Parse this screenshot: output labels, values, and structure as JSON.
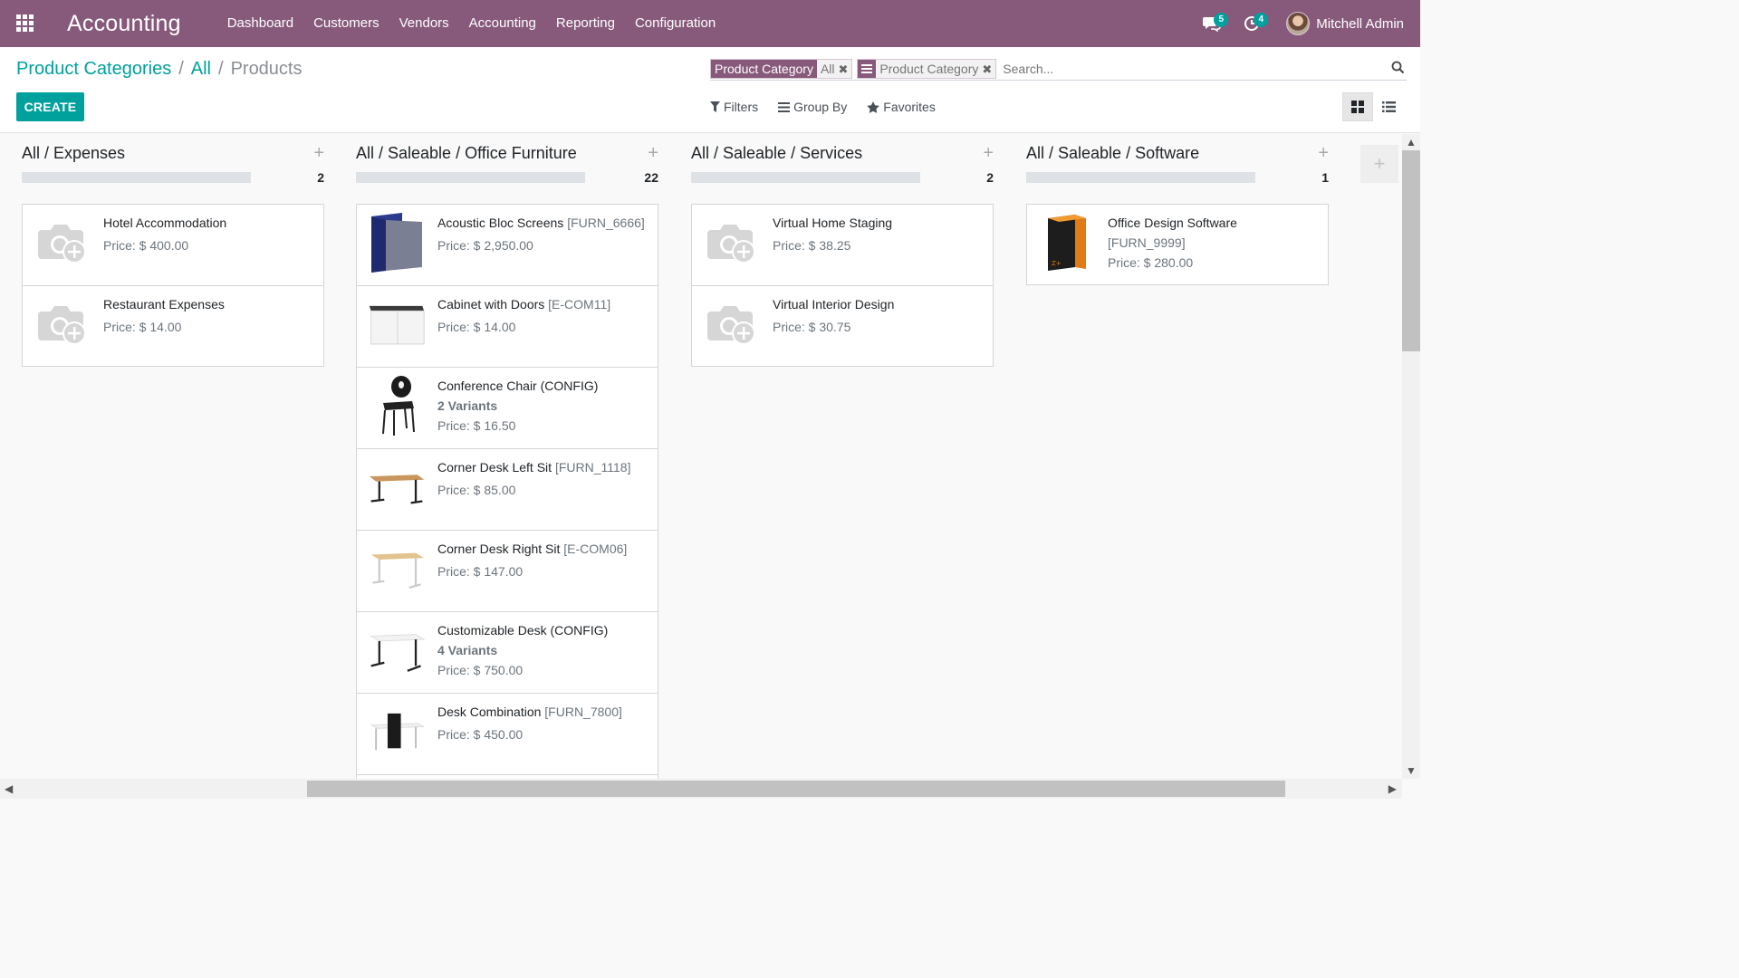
{
  "colors": {
    "brand": "#875a7b",
    "accent": "#00a09d"
  },
  "navbar": {
    "app_name": "Accounting",
    "menu": [
      "Dashboard",
      "Customers",
      "Vendors",
      "Accounting",
      "Reporting",
      "Configuration"
    ],
    "messages_count": "5",
    "activities_count": "4",
    "user_name": "Mitchell Admin"
  },
  "breadcrumb": {
    "level1": "Product Categories",
    "level2": "All",
    "current": "Products",
    "sep": "/"
  },
  "toolbar": {
    "create_label": "CREATE"
  },
  "search": {
    "facet1_label": "Product Category",
    "facet1_value": "All",
    "facet2_value": "Product Category",
    "placeholder": "Search...",
    "filters_label": "Filters",
    "groupby_label": "Group By",
    "favorites_label": "Favorites"
  },
  "columns": [
    {
      "title": "All / Expenses",
      "count": "2",
      "cards": [
        {
          "name": "Hotel Accommodation",
          "ref": "",
          "variants": "",
          "price": "Price: $ 400.00",
          "image": "placeholder"
        },
        {
          "name": "Restaurant Expenses",
          "ref": "",
          "variants": "",
          "price": "Price: $ 14.00",
          "image": "placeholder"
        }
      ]
    },
    {
      "title": "All / Saleable / Office Furniture",
      "count": "22",
      "cards": [
        {
          "name": "Acoustic Bloc Screens",
          "ref": "[FURN_6666]",
          "variants": "",
          "price": "Price: $ 2,950.00",
          "image": "screens"
        },
        {
          "name": "Cabinet with Doors",
          "ref": "[E-COM11]",
          "variants": "",
          "price": "Price: $ 14.00",
          "image": "cabinet"
        },
        {
          "name": "Conference Chair (CONFIG)",
          "ref": "",
          "variants": "2 Variants",
          "price": "Price: $ 16.50",
          "image": "chair"
        },
        {
          "name": "Corner Desk Left Sit",
          "ref": "[FURN_1118]",
          "variants": "",
          "price": "Price: $ 85.00",
          "image": "desk-left"
        },
        {
          "name": "Corner Desk Right Sit",
          "ref": "[E-COM06]",
          "variants": "",
          "price": "Price: $ 147.00",
          "image": "desk-right"
        },
        {
          "name": "Customizable Desk (CONFIG)",
          "ref": "",
          "variants": "4 Variants",
          "price": "Price: $ 750.00",
          "image": "desk-custom"
        },
        {
          "name": "Desk Combination",
          "ref": "[FURN_7800]",
          "variants": "",
          "price": "Price: $ 450.00",
          "image": "desk-combo"
        }
      ]
    },
    {
      "title": "All / Saleable / Services",
      "count": "2",
      "cards": [
        {
          "name": "Virtual Home Staging",
          "ref": "",
          "variants": "",
          "price": "Price: $ 38.25",
          "image": "placeholder"
        },
        {
          "name": "Virtual Interior Design",
          "ref": "",
          "variants": "",
          "price": "Price: $ 30.75",
          "image": "placeholder"
        }
      ]
    },
    {
      "title": "All / Saleable / Software",
      "count": "1",
      "cards": [
        {
          "name": "Office Design Software",
          "ref": "[FURN_9999]",
          "variants": "",
          "price": "Price: $ 280.00",
          "image": "software"
        }
      ]
    }
  ]
}
